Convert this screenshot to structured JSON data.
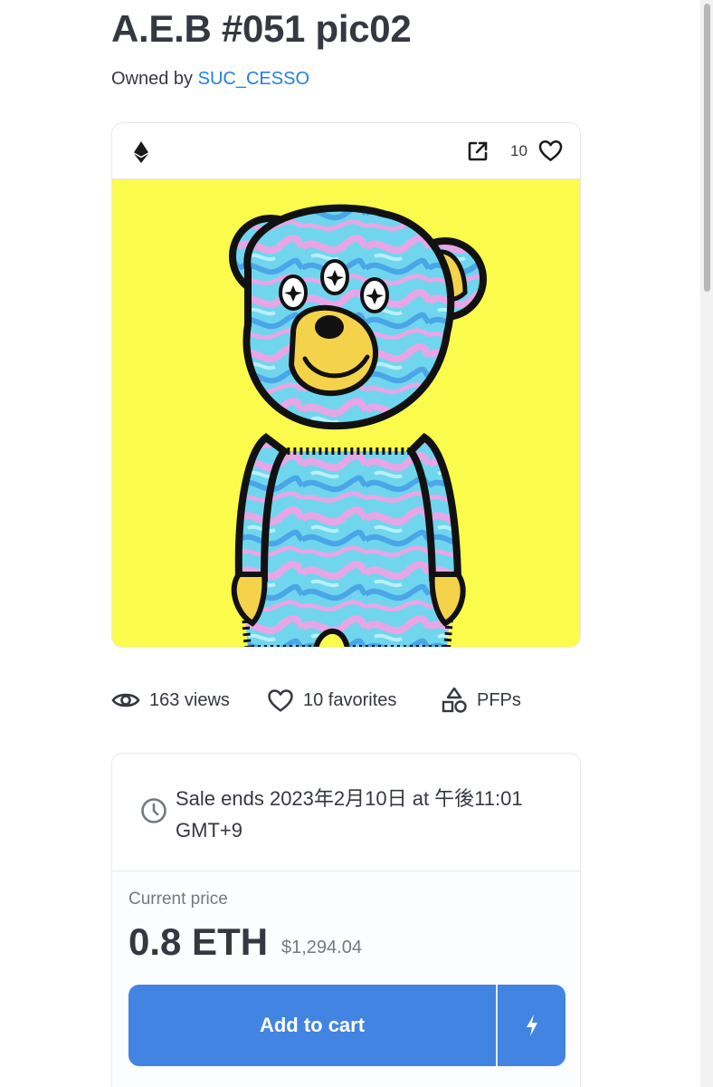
{
  "item": {
    "title": "A.E.B #051 pic02",
    "owned_by_label": "Owned by",
    "owner_name": "SUC_CESSO"
  },
  "media": {
    "chain_icon": "ethereum-icon",
    "external_link_icon": "external-link-icon",
    "favorite_count": "10",
    "favorite_icon": "heart-icon",
    "background_color": "#fbfb4c"
  },
  "stats": {
    "views": "163 views",
    "favorites": "10 favorites",
    "category": "PFPs"
  },
  "sale": {
    "ends_text": "Sale ends 2023年2月10日 at 午後11:01 GMT+9",
    "price_label": "Current price",
    "price_eth": "0.8 ETH",
    "price_usd": "$1,294.04",
    "add_to_cart_label": "Add to cart",
    "quick_buy_icon": "lightning-icon",
    "accent_color": "#4284e2"
  }
}
